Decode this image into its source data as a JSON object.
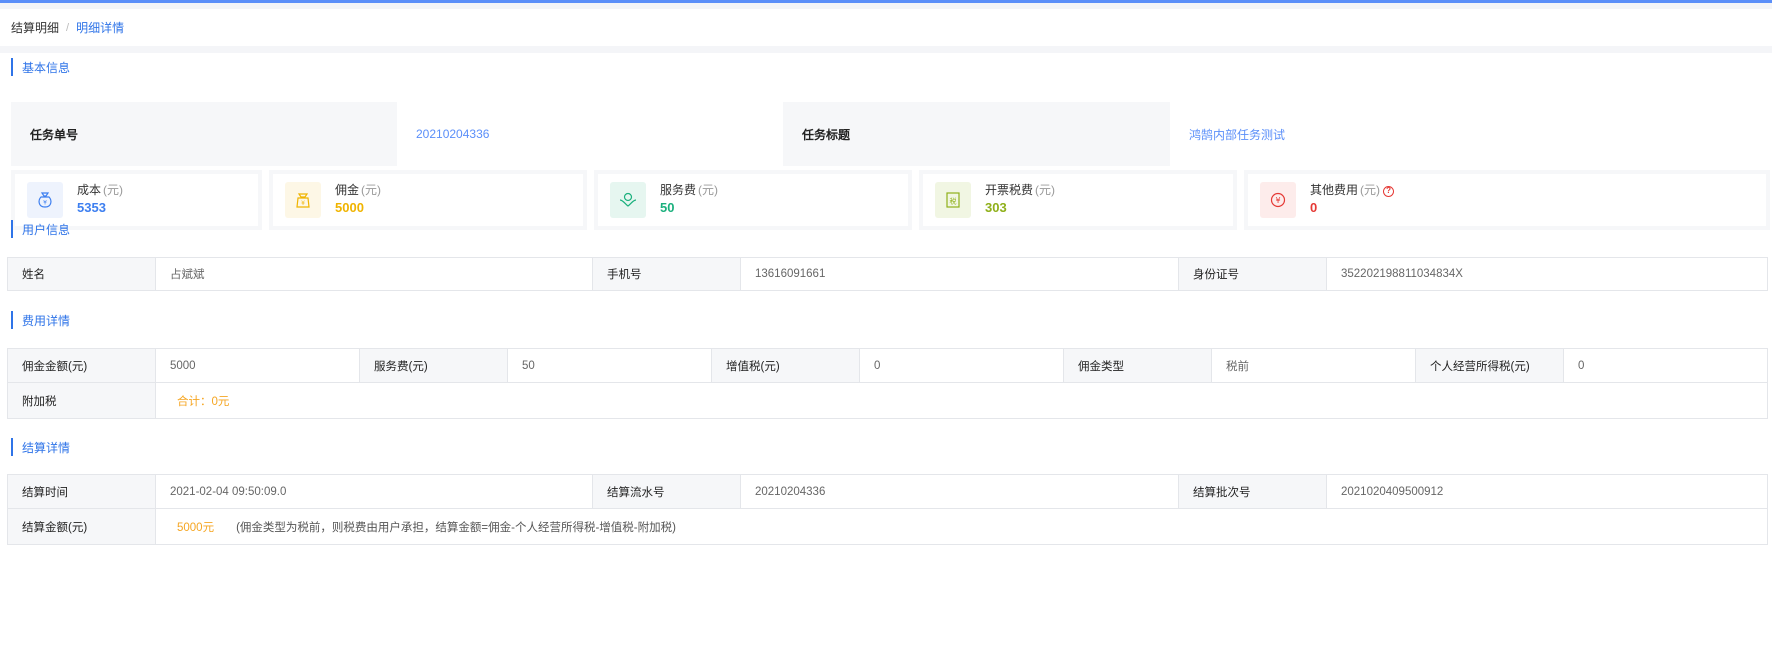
{
  "breadcrumb": {
    "parent": "结算明细",
    "separator": "/",
    "current": "明细详情"
  },
  "sections": {
    "basic": "基本信息",
    "user": "用户信息",
    "fee": "费用详情",
    "settle": "结算详情"
  },
  "basic_info": {
    "task_no_label": "任务单号",
    "task_no_value": "20210204336",
    "task_title_label": "任务标题",
    "task_title_value": "鸿鹄内部任务测试"
  },
  "fee_cards": [
    {
      "label": "成本",
      "unit": "(元)",
      "value": "5353",
      "icon": "money-bag-icon",
      "color": "#3d7ff0",
      "bg": "#eef3fd"
    },
    {
      "label": "佣金",
      "unit": "(元)",
      "value": "5000",
      "icon": "commission-bag-icon",
      "color": "#f0b400",
      "bg": "#fdf7e6"
    },
    {
      "label": "服务费",
      "unit": "(元)",
      "value": "50",
      "icon": "hand-coin-icon",
      "color": "#1bb07d",
      "bg": "#e6f6f0"
    },
    {
      "label": "开票税费",
      "unit": "(元)",
      "value": "303",
      "icon": "tax-icon",
      "color": "#8fb01a",
      "bg": "#f1f6e3"
    },
    {
      "label": "其他费用",
      "unit": "(元)",
      "value": "0",
      "icon": "yen-circle-icon",
      "color": "#e53935",
      "bg": "#fdeceb",
      "help": "?"
    }
  ],
  "user_info": {
    "name_label": "姓名",
    "name_value": "占斌斌",
    "phone_label": "手机号",
    "phone_value": "13616091661",
    "id_label": "身份证号",
    "id_value": "352202198811034834X"
  },
  "fee_detail": {
    "commission_label": "佣金金额(元)",
    "commission_value": "5000",
    "service_label": "服务费(元)",
    "service_value": "50",
    "vat_label": "增值税(元)",
    "vat_value": "0",
    "type_label": "佣金类型",
    "type_value": "税前",
    "income_tax_label": "个人经营所得税(元)",
    "income_tax_value": "0",
    "surtax_label": "附加税",
    "surtax_value": "合计：0元"
  },
  "settle_detail": {
    "time_label": "结算时间",
    "time_value": "2021-02-04 09:50:09.0",
    "serial_label": "结算流水号",
    "serial_value": "20210204336",
    "batch_label": "结算批次号",
    "batch_value": "2021020409500912",
    "amount_label": "结算金额(元)",
    "amount_value": "5000元",
    "amount_note": "(佣金类型为税前，则税费由用户承担，结算金额=佣金-个人经营所得税-增值税-附加税)"
  }
}
